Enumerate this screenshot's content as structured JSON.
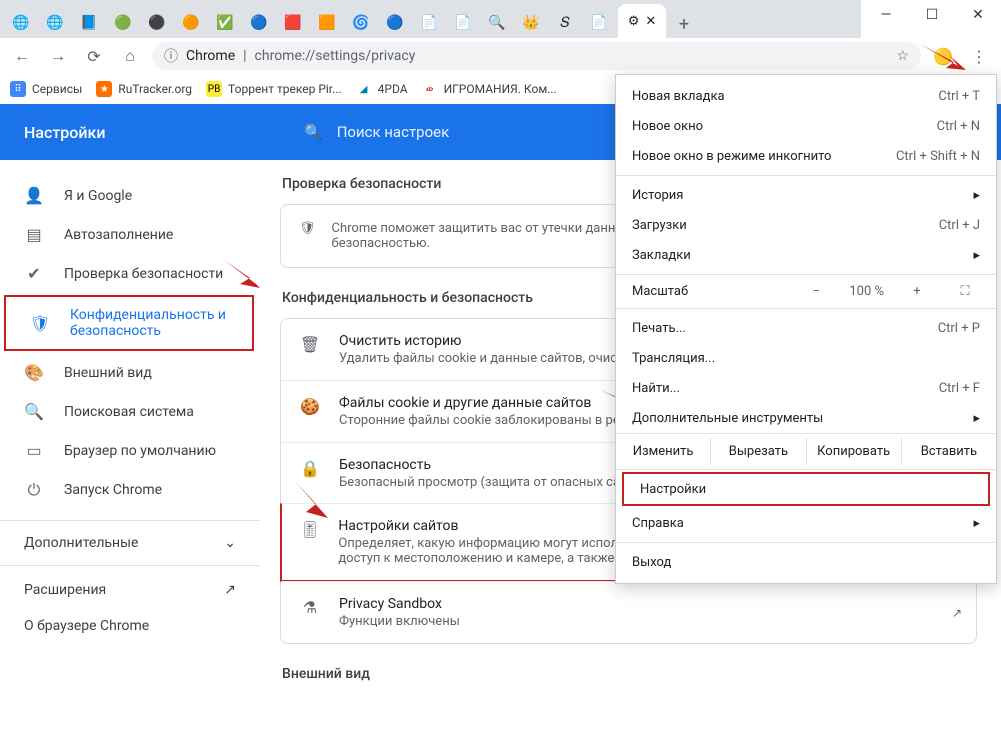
{
  "window": {
    "url_host": "Chrome",
    "url_path": "chrome://settings/privacy"
  },
  "bookmarks": [
    {
      "label": "Сервисы",
      "color": "#4285f4"
    },
    {
      "label": "RuTracker.org",
      "color": "#ff6f00"
    },
    {
      "label": "Торрент трекер Pir...",
      "color": "#ffeb3b"
    },
    {
      "label": "4PDA",
      "color": "#0277bd"
    },
    {
      "label": "ИГРОМАНИЯ. Ком...",
      "color": "#d50000"
    }
  ],
  "settings_header": {
    "title": "Настройки",
    "search_placeholder": "Поиск настроек"
  },
  "sidebar": {
    "items": [
      {
        "label": "Я и Google",
        "icon": "👤"
      },
      {
        "label": "Автозаполнение",
        "icon": "▤"
      },
      {
        "label": "Проверка безопасности",
        "icon": "✔"
      },
      {
        "label": "Конфиденциальность и безопасность",
        "icon": "🛡"
      },
      {
        "label": "Внешний вид",
        "icon": "🎨"
      },
      {
        "label": "Поисковая система",
        "icon": "🔍"
      },
      {
        "label": "Браузер по умолчанию",
        "icon": "▭"
      },
      {
        "label": "Запуск Chrome",
        "icon": "⏻"
      }
    ],
    "advanced": "Дополнительные",
    "extensions": "Расширения",
    "about": "О браузере Chrome"
  },
  "main": {
    "safety_section": "Проверка безопасности",
    "safety_text": "Chrome поможет защитить вас от утечки данных, небезопасных расширений и других проблем с безопасностью.",
    "privacy_section": "Конфиденциальность и безопасность",
    "rows": [
      {
        "title": "Очистить историю",
        "sub": "Удалить файлы cookie и данные сайтов, очистить историю и кеш"
      },
      {
        "title": "Файлы cookie и другие данные сайтов",
        "sub": "Сторонние файлы cookie заблокированы в режиме инкогнито"
      },
      {
        "title": "Безопасность",
        "sub": "Безопасный просмотр (защита от опасных сайтов) и другие настройки безопасности"
      },
      {
        "title": "Настройки сайтов",
        "sub": "Определяет, какую информацию могут использовать и показывать сайты (например, есть ли у них доступ к местоположению и камере, а также разрешение на показ всплывающих окон и т. д.)."
      },
      {
        "title": "Privacy Sandbox",
        "sub": "Функции включены"
      }
    ],
    "appearance_section": "Внешний вид"
  },
  "menu": {
    "new_tab": "Новая вкладка",
    "new_tab_sc": "Ctrl + T",
    "new_window": "Новое окно",
    "new_window_sc": "Ctrl + N",
    "incognito": "Новое окно в режиме инкогнито",
    "incognito_sc": "Ctrl + Shift + N",
    "history": "История",
    "downloads": "Загрузки",
    "downloads_sc": "Ctrl + J",
    "bookmarks": "Закладки",
    "zoom": "Масштаб",
    "zoom_value": "100 %",
    "print": "Печать...",
    "print_sc": "Ctrl + P",
    "cast": "Трансляция...",
    "find": "Найти...",
    "find_sc": "Ctrl + F",
    "more_tools": "Дополнительные инструменты",
    "edit_label": "Изменить",
    "cut": "Вырезать",
    "copy": "Копировать",
    "paste": "Вставить",
    "settings": "Настройки",
    "help": "Справка",
    "exit": "Выход"
  }
}
